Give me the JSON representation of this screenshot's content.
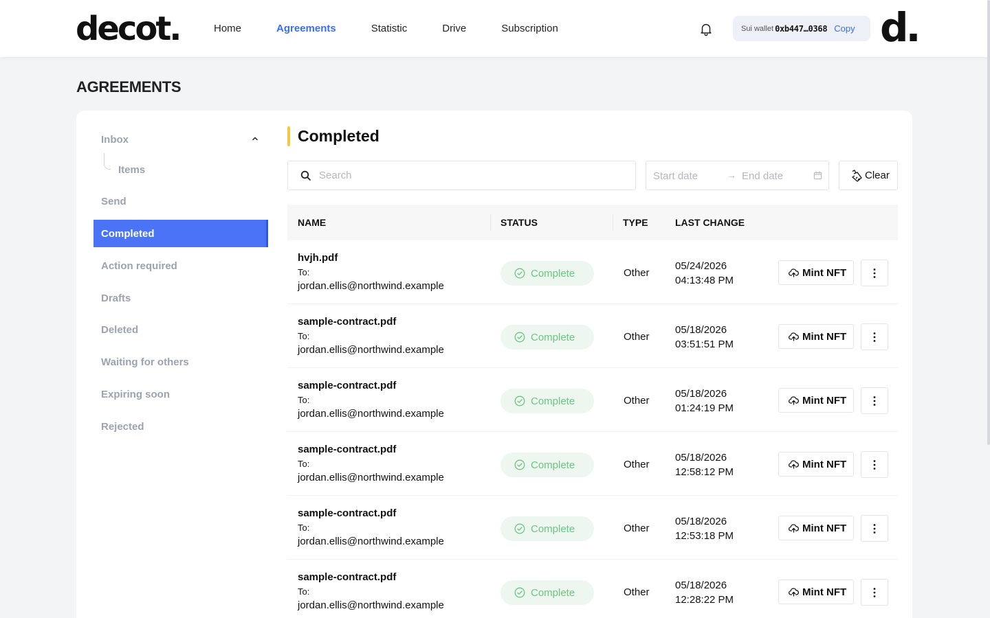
{
  "header": {
    "logo": "decot.",
    "nav": [
      "Home",
      "Agreements",
      "Statistic",
      "Drive",
      "Subscription"
    ],
    "active_nav": "Agreements",
    "wallet_label": "Sui wallet",
    "wallet_address": "0xb447…0368",
    "copy_label": "Copy",
    "avatar": "d."
  },
  "page_title": "AGREEMENTS",
  "sidebar": {
    "inbox": "Inbox",
    "items_label": "Items",
    "send": "Send",
    "completed": "Completed",
    "action_required": "Action required",
    "drafts": "Drafts",
    "deleted": "Deleted",
    "waiting": "Waiting for others",
    "expiring": "Expiring soon",
    "rejected": "Rejected"
  },
  "main": {
    "section_title": "Completed",
    "search_placeholder": "Search",
    "start_date_placeholder": "Start date",
    "date_arrow": "→",
    "end_date_placeholder": "End date",
    "clear_label": "Clear",
    "columns": {
      "name": "NAME",
      "status": "STATUS",
      "type": "TYPE",
      "last_change": "LAST CHANGE"
    },
    "to_label": "To:",
    "status_label": "Complete",
    "mint_label": "Mint NFT",
    "rows": [
      {
        "file": "hvjh.pdf",
        "email": "jordan.ellis@northwind.example",
        "type": "Other",
        "date": "05/24/2026",
        "time": "04:13:48 PM"
      },
      {
        "file": "sample-contract.pdf",
        "email": "jordan.ellis@northwind.example",
        "type": "Other",
        "date": "05/18/2026",
        "time": "03:51:51 PM"
      },
      {
        "file": "sample-contract.pdf",
        "email": "jordan.ellis@northwind.example",
        "type": "Other",
        "date": "05/18/2026",
        "time": "01:24:19 PM"
      },
      {
        "file": "sample-contract.pdf",
        "email": "jordan.ellis@northwind.example",
        "type": "Other",
        "date": "05/18/2026",
        "time": "12:58:12 PM"
      },
      {
        "file": "sample-contract.pdf",
        "email": "jordan.ellis@northwind.example",
        "type": "Other",
        "date": "05/18/2026",
        "time": "12:53:18 PM"
      },
      {
        "file": "sample-contract.pdf",
        "email": "jordan.ellis@northwind.example",
        "type": "Other",
        "date": "05/18/2026",
        "time": "12:28:22 PM"
      }
    ]
  },
  "colors": {
    "accent": "#3b6ef5",
    "sidebar_active": "#4a74f5",
    "status_green": "#6cc383",
    "status_bg": "#eef7ef",
    "section_bar": "#f5c842"
  }
}
